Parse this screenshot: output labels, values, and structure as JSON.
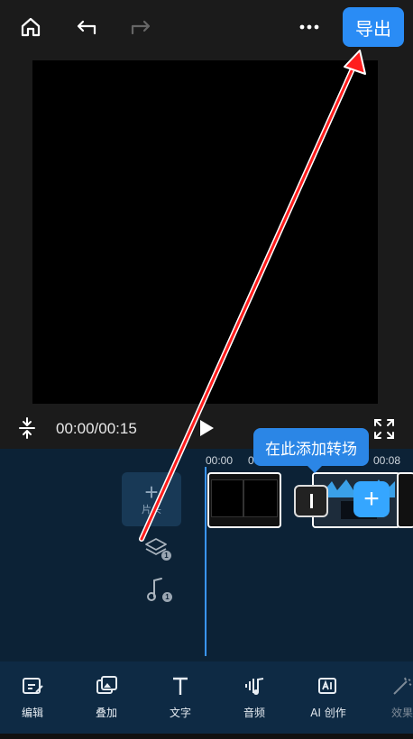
{
  "topbar": {
    "home_icon": "home-icon",
    "undo_icon": "undo-icon",
    "redo_icon": "redo-icon",
    "more_icon": "more-icon",
    "export_label": "导出"
  },
  "player": {
    "timecode": "00:00/00:15",
    "fit_icon": "vertical-fit-icon",
    "play_icon": "play-icon",
    "fullscreen_icon": "fullscreen-icon"
  },
  "timeline": {
    "ruler": [
      "00:00",
      "0",
      "0",
      "00:08"
    ],
    "add_clip_label": "片头",
    "tooltip": "在此添加转场",
    "overlay_count": "1",
    "audio_count": "1"
  },
  "toolbar": {
    "items": [
      {
        "label": "编辑",
        "icon": "edit-icon"
      },
      {
        "label": "叠加",
        "icon": "overlay-icon"
      },
      {
        "label": "文字",
        "icon": "text-icon"
      },
      {
        "label": "音频",
        "icon": "audio-icon"
      },
      {
        "label": "AI 创作",
        "icon": "ai-create-icon"
      },
      {
        "label": "效果",
        "icon": "effects-icon"
      }
    ]
  },
  "colors": {
    "accent": "#2a8cf5",
    "timeline_bg": "#0c2236",
    "toolbar_bg": "#0e2a44",
    "annotation_arrow": "#ff1e1e"
  }
}
